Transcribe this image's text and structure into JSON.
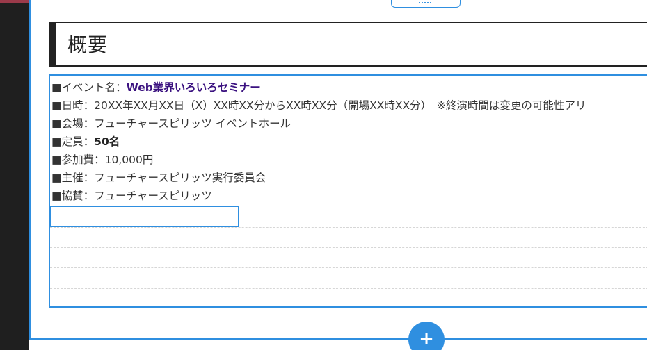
{
  "heading": {
    "title": "概要"
  },
  "info": {
    "event_label": "■イベント名：",
    "event_value": "Web業界いろいろセミナー",
    "datetime": "■日時：20XX年XX月XX日（X）XX時XX分からXX時XX分（開場XX時XX分）　※終演時間は変更の可能性アリ",
    "venue": "■会場：フューチャースピリッツ イベントホール",
    "capacity_label": "■定員：",
    "capacity_value": "50名",
    "fee": "■参加費：10,000円",
    "organizer": "■主催：フューチャースピリッツ実行委員会",
    "sponsor": "■協賛：フューチャースピリッツ"
  },
  "controls": {
    "add_label": "+"
  },
  "colors": {
    "selection": "#2f8fe0",
    "accent_text": "#3b1280",
    "rail": "#1f1f1f"
  },
  "icons": {
    "drag_handle": "drag-handle-icon",
    "add": "plus-icon"
  }
}
